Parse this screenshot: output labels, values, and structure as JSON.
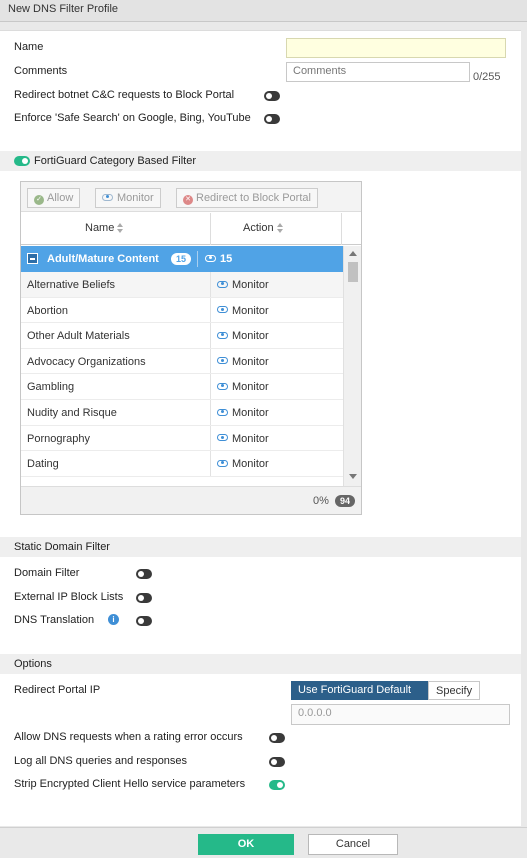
{
  "window": {
    "title": "New DNS Filter Profile"
  },
  "form": {
    "name_label": "Name",
    "name_value": "",
    "comments_label": "Comments",
    "comments_placeholder": "Comments",
    "comments_counter": "0/255",
    "redirect_botnet_label": "Redirect botnet C&C requests to Block Portal",
    "redirect_botnet_on": false,
    "safe_search_label": "Enforce 'Safe Search' on Google, Bing, YouTube",
    "safe_search_on": false
  },
  "fortiguard": {
    "label": "FortiGuard Category Based Filter",
    "enabled": true,
    "toolbar": {
      "allow": "Allow",
      "monitor": "Monitor",
      "redirect": "Redirect to Block Portal"
    },
    "columns": {
      "name": "Name",
      "action": "Action"
    },
    "group": {
      "name": "Adult/Mature Content",
      "count": "15",
      "monitor_count": "15"
    },
    "rows": [
      {
        "name": "Alternative Beliefs",
        "action": "Monitor"
      },
      {
        "name": "Abortion",
        "action": "Monitor"
      },
      {
        "name": "Other Adult Materials",
        "action": "Monitor"
      },
      {
        "name": "Advocacy Organizations",
        "action": "Monitor"
      },
      {
        "name": "Gambling",
        "action": "Monitor"
      },
      {
        "name": "Nudity and Risque",
        "action": "Monitor"
      },
      {
        "name": "Pornography",
        "action": "Monitor"
      },
      {
        "name": "Dating",
        "action": "Monitor"
      }
    ],
    "footer": {
      "percent": "0%",
      "total": "94"
    }
  },
  "static_domain": {
    "title": "Static Domain Filter",
    "domain_filter": "Domain Filter",
    "external_ip": "External IP Block Lists",
    "dns_translation": "DNS Translation",
    "info_glyph": "i"
  },
  "options": {
    "title": "Options",
    "redirect_portal_ip": "Redirect Portal IP",
    "use_default": "Use FortiGuard Default",
    "specify": "Specify",
    "ip_placeholder": "0.0.0.0",
    "allow_dns_error": "Allow DNS requests when a rating error occurs",
    "log_all": "Log all DNS queries and responses",
    "strip_ech": "Strip Encrypted Client Hello service parameters",
    "strip_ech_on": true
  },
  "buttons": {
    "ok": "OK",
    "cancel": "Cancel"
  },
  "colors": {
    "accent": "#25b989",
    "selection": "#50a3e6",
    "info": "#3f8fd6"
  },
  "icons": {
    "allow": "check-circle-icon",
    "monitor": "eye-icon",
    "redirect": "x-circle-icon",
    "collapse": "minus-square-icon"
  }
}
